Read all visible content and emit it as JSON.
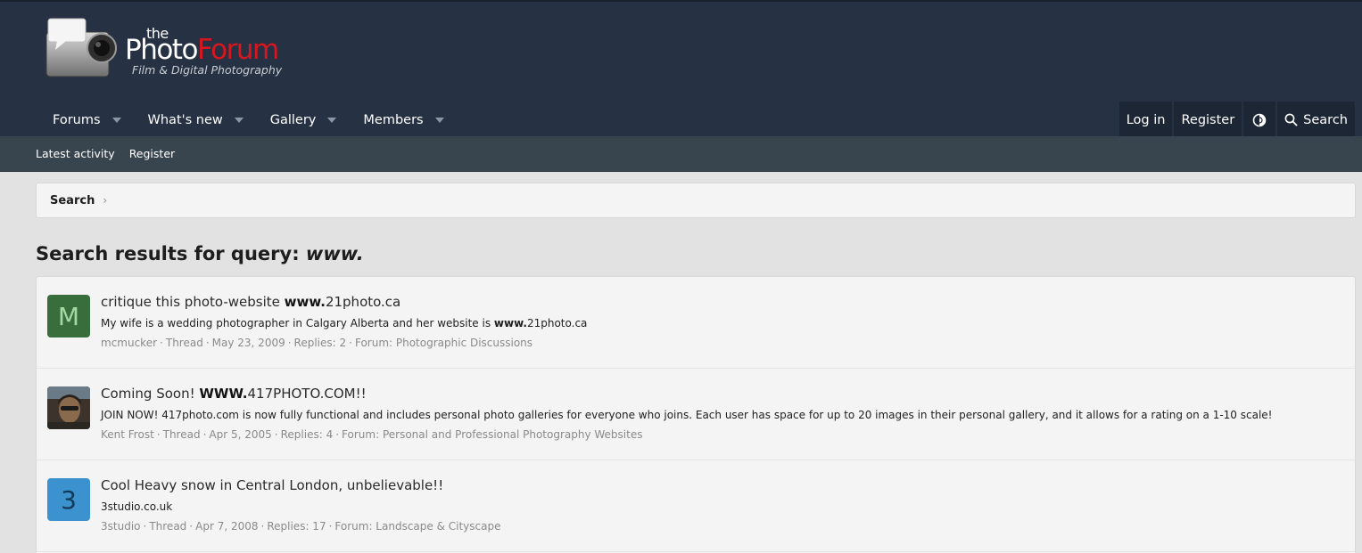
{
  "logo": {
    "the": "the",
    "photo": "Photo",
    "forum": "Forum",
    "tagline": "Film & Digital Photography"
  },
  "nav": {
    "tabs": [
      {
        "label": "Forums"
      },
      {
        "label": "What's new"
      },
      {
        "label": "Gallery"
      },
      {
        "label": "Members"
      }
    ],
    "login": "Log in",
    "register": "Register",
    "search": "Search"
  },
  "subnav": {
    "items": [
      "Latest activity",
      "Register"
    ]
  },
  "breadcrumb": {
    "items": [
      "Search"
    ]
  },
  "page": {
    "title_prefix": "Search results for query: ",
    "query": "www."
  },
  "results": [
    {
      "avatar_letter": "M",
      "title_prefix": "critique this photo-website ",
      "title_match": "www.",
      "title_suffix": "21photo.ca",
      "snippet_prefix": "My wife is a wedding photographer in Calgary Alberta and her website is ",
      "snippet_match": "www.",
      "snippet_suffix": "21photo.ca",
      "author": "mcmucker",
      "type": "Thread",
      "date": "May 23, 2009",
      "replies": "Replies: 2",
      "forum": "Forum: Photographic Discussions"
    },
    {
      "avatar_letter": "",
      "title_prefix": "Coming Soon! ",
      "title_match": "WWW.",
      "title_suffix": "417PHOTO.COM!!",
      "snippet_prefix": "JOIN NOW! 417photo.com is now fully functional and includes personal photo galleries for everyone who joins. Each user has space for up to 20 images in their personal gallery, and it allows for a rating on a 1-10 scale!",
      "snippet_match": "",
      "snippet_suffix": "",
      "author": "Kent Frost",
      "type": "Thread",
      "date": "Apr 5, 2005",
      "replies": "Replies: 4",
      "forum": "Forum: Personal and Professional Photography Websites"
    },
    {
      "avatar_letter": "3",
      "title_prefix": "Cool Heavy snow in Central London, unbelievable!!",
      "title_match": "",
      "title_suffix": "",
      "snippet_prefix": "3studio.co.uk",
      "snippet_match": "",
      "snippet_suffix": "",
      "author": "3studio",
      "type": "Thread",
      "date": "Apr 7, 2008",
      "replies": "Replies: 17",
      "forum": "Forum: Landscape & Cityscape"
    }
  ]
}
